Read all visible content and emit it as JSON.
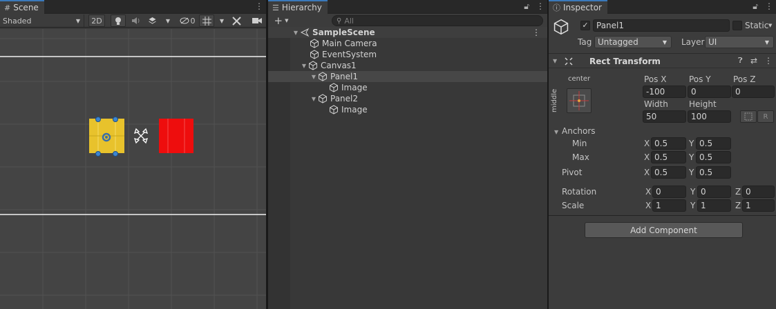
{
  "scene": {
    "tab_label": "Scene",
    "shading_mode": "Shaded",
    "btn_2d": "2D",
    "hidden_count": "0"
  },
  "hierarchy": {
    "tab_label": "Hierarchy",
    "add_label": "+",
    "search_placeholder": "All",
    "items": [
      {
        "label": "SampleScene"
      },
      {
        "label": "Main Camera"
      },
      {
        "label": "EventSystem"
      },
      {
        "label": "Canvas1"
      },
      {
        "label": "Panel1"
      },
      {
        "label": "Image"
      },
      {
        "label": "Panel2"
      },
      {
        "label": "Image"
      }
    ]
  },
  "inspector": {
    "tab_label": "Inspector",
    "object_name": "Panel1",
    "static_label": "Static",
    "tag_label": "Tag",
    "tag_value": "Untagged",
    "layer_label": "Layer",
    "layer_value": "UI",
    "component_title": "Rect Transform",
    "anchor_h": "center",
    "anchor_v": "middle",
    "pos_x_label": "Pos X",
    "pos_y_label": "Pos Y",
    "pos_z_label": "Pos Z",
    "pos_x": "-100",
    "pos_y": "0",
    "pos_z": "0",
    "width_label": "Width",
    "height_label": "Height",
    "width": "50",
    "height": "100",
    "r_label": "R",
    "anchors_label": "Anchors",
    "min_label": "Min",
    "max_label": "Max",
    "pivot_label": "Pivot",
    "rotation_label": "Rotation",
    "scale_label": "Scale",
    "x": "X",
    "y": "Y",
    "z": "Z",
    "min_x": "0.5",
    "min_y": "0.5",
    "max_x": "0.5",
    "max_y": "0.5",
    "pivot_x": "0.5",
    "pivot_y": "0.5",
    "rot_x": "0",
    "rot_y": "0",
    "rot_z": "0",
    "scale_x": "1",
    "scale_y": "1",
    "scale_z": "1",
    "add_component": "Add Component"
  },
  "colors": {
    "accent": "#3a79bb",
    "yellow_panel": "#e8c22c",
    "red_panel": "#ee0d0d"
  }
}
